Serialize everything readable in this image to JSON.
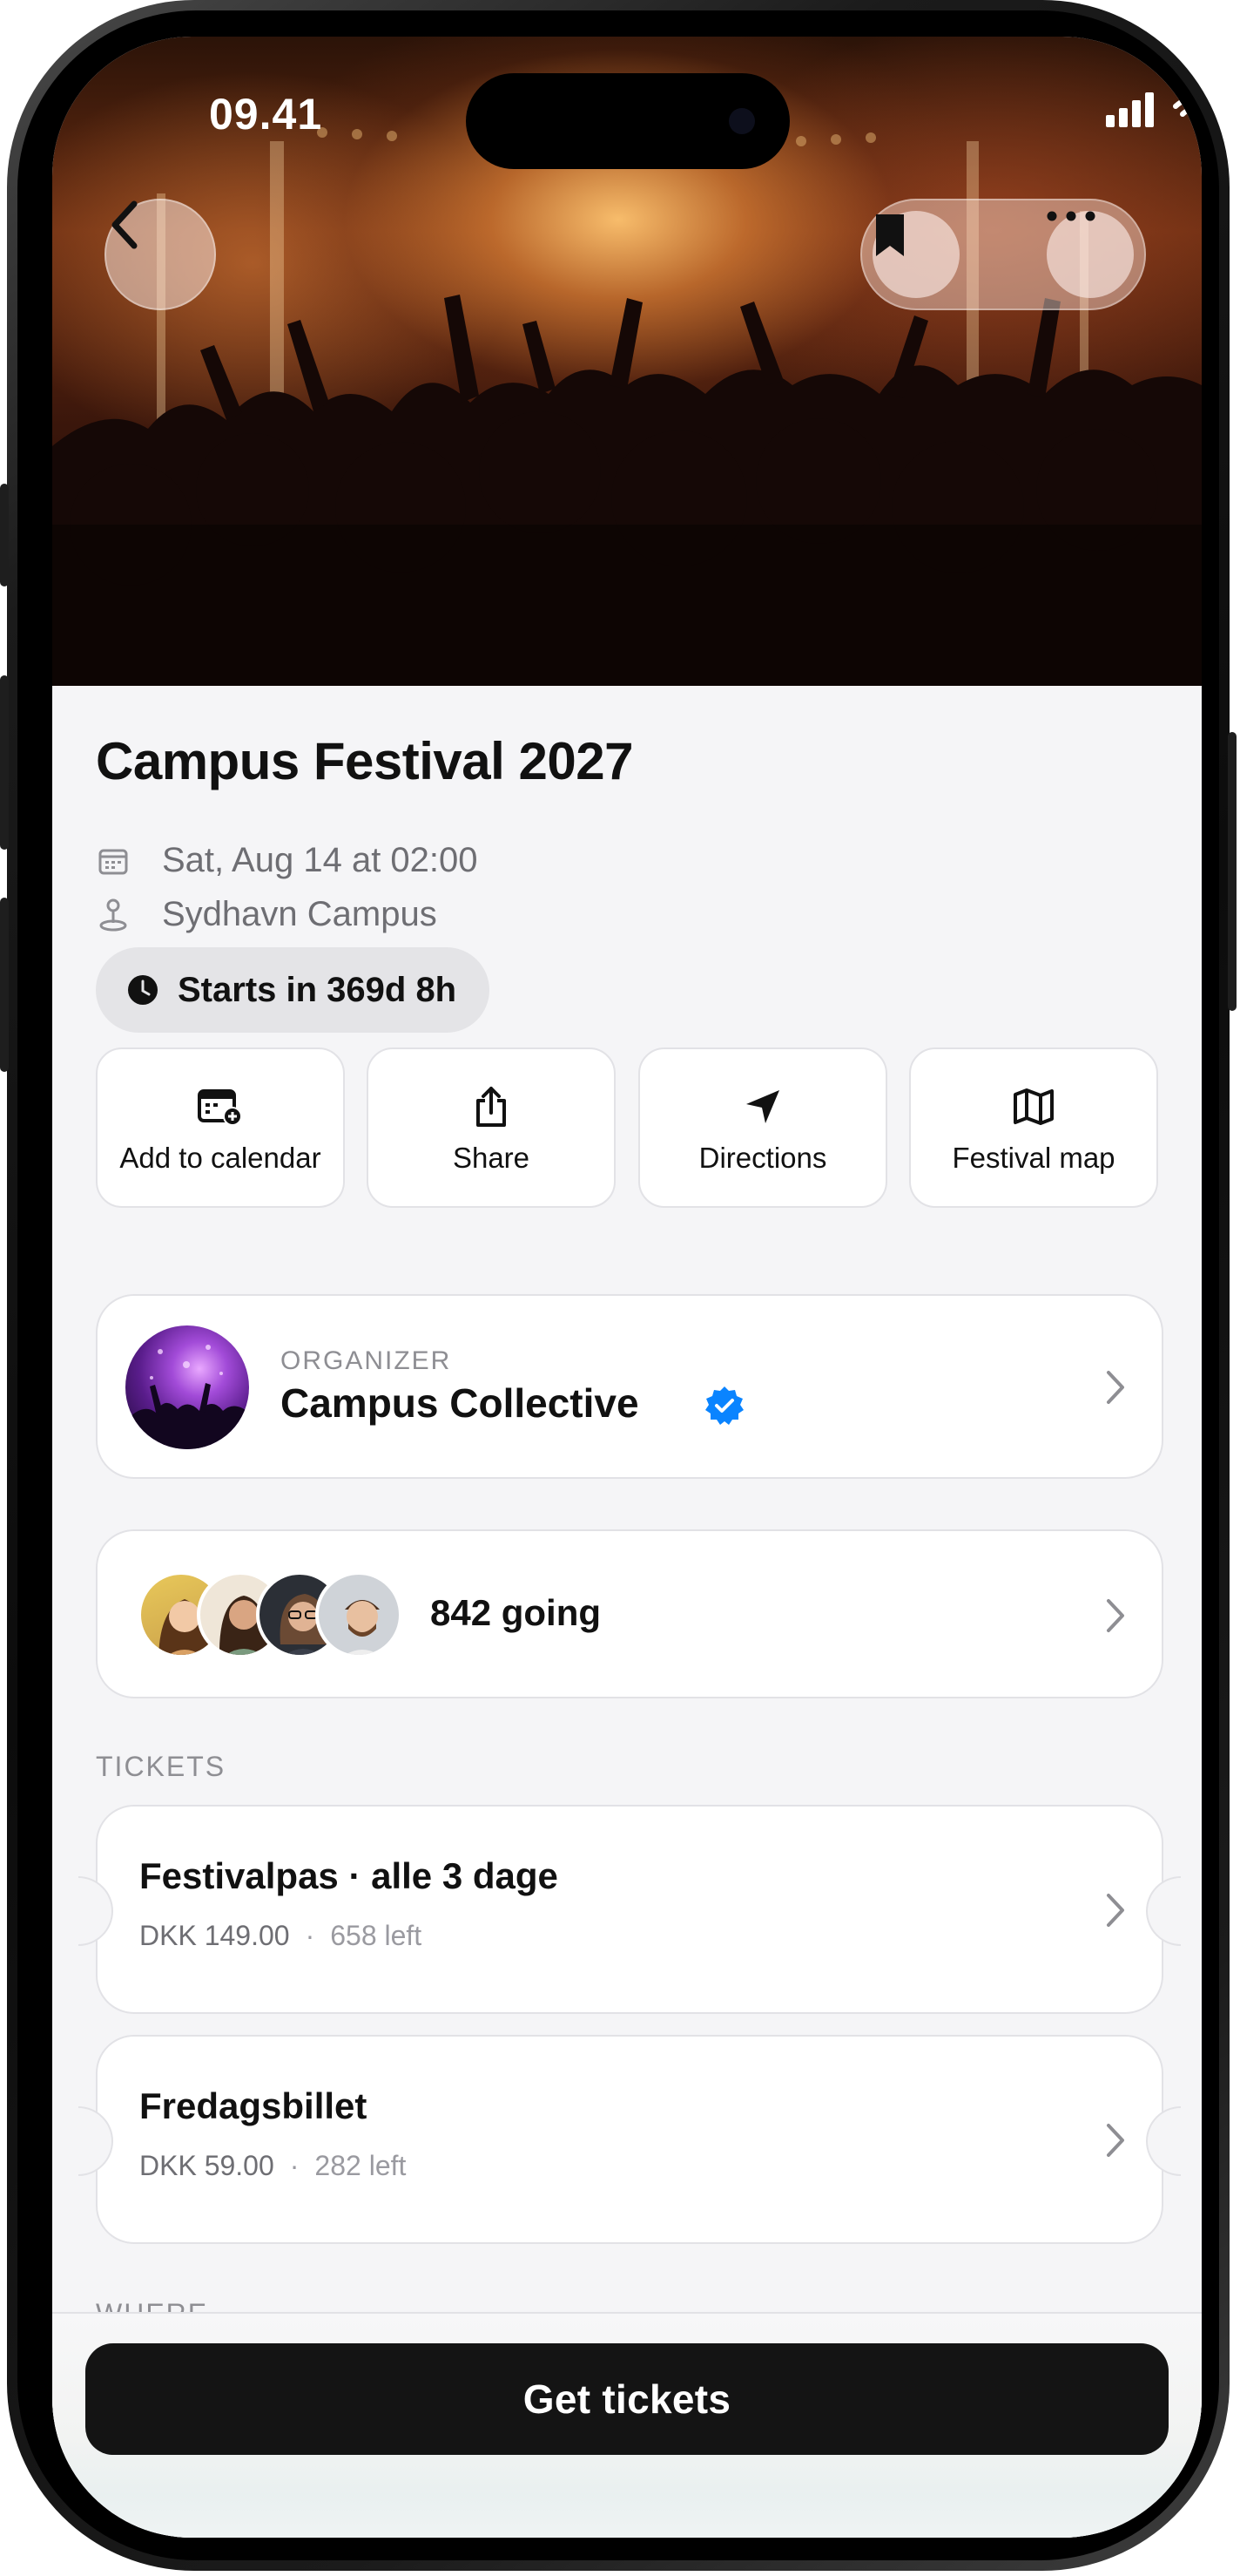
{
  "status_bar": {
    "time": "09.41"
  },
  "event": {
    "title": "Campus Festival 2027",
    "date": "Sat, Aug 14 at 02:00",
    "location": "Sydhavn Campus",
    "countdown": "Starts in 369d 8h"
  },
  "actions": [
    {
      "label": "Add to calendar",
      "icon": "calendar-add-icon"
    },
    {
      "label": "Share",
      "icon": "share-icon"
    },
    {
      "label": "Directions",
      "icon": "location-arrow-icon"
    },
    {
      "label": "Festival map",
      "icon": "map-icon"
    }
  ],
  "organizer": {
    "kicker": "ORGANIZER",
    "name": "Campus Collective",
    "verified": true
  },
  "attendance": {
    "text": "842 going"
  },
  "tickets": {
    "heading": "TICKETS",
    "items": [
      {
        "name": "Festivalpas · alle 3 dage",
        "price": "DKK 149.00",
        "left": "658 left"
      },
      {
        "name": "Fredagsbillet",
        "price": "DKK 59.00",
        "left": "282 left"
      }
    ]
  },
  "where": {
    "heading": "WHERE"
  },
  "cta": {
    "label": "Get tickets"
  },
  "colors": {
    "accent": "#0a84ff",
    "cta_background": "#141414",
    "battery": "#34c759"
  }
}
